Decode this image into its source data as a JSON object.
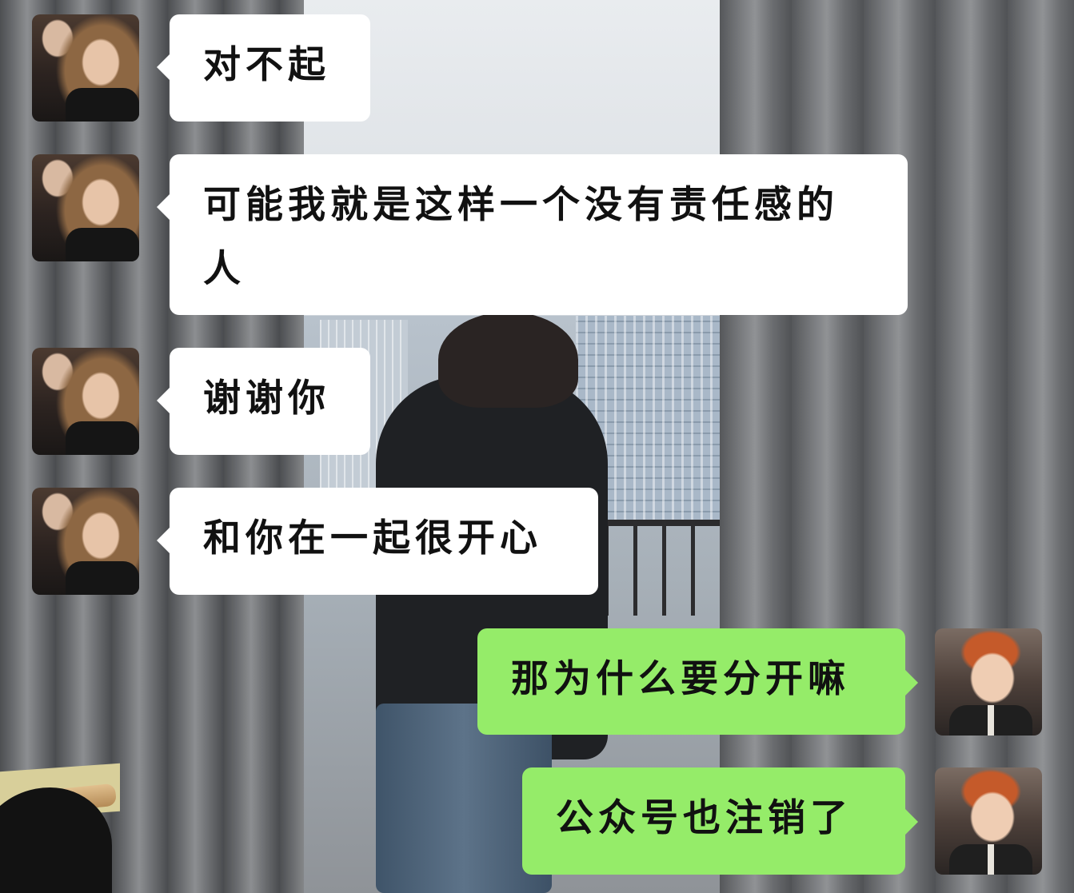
{
  "chat": {
    "messages": [
      {
        "sender": "left",
        "text": "对不起"
      },
      {
        "sender": "left",
        "text": "可能我就是这样一个没有责任感的人"
      },
      {
        "sender": "left",
        "text": "谢谢你"
      },
      {
        "sender": "left",
        "text": "和你在一起很开心"
      },
      {
        "sender": "right",
        "text": "那为什么要分开嘛"
      },
      {
        "sender": "right",
        "text": "公众号也注销了"
      }
    ]
  },
  "colors": {
    "left_bubble": "#ffffff",
    "right_bubble": "#95ec69"
  },
  "icons": {
    "left_avatar": "girl-avatar",
    "right_avatar": "boy-avatar"
  }
}
